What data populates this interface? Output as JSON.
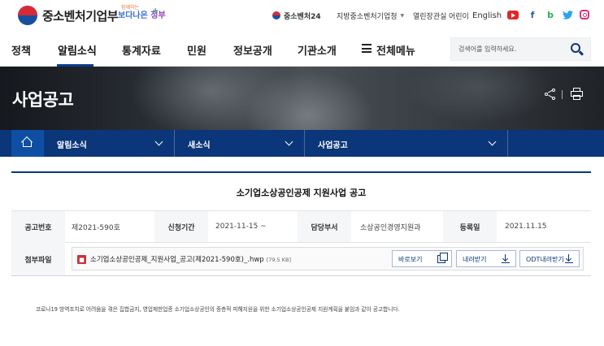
{
  "header": {
    "logo_text": "중소벤처기업부",
    "slogan_small": "함께하는",
    "slogan_big_1": "보다나은",
    "slogan_big_2": "정부",
    "utility": {
      "sme24": "중소벤처24",
      "region": "지방중소벤처기업청",
      "open": "열린장관실",
      "kids": "어린이",
      "english": "English"
    },
    "sns": [
      "youtube-icon",
      "facebook-icon",
      "blog-icon",
      "twitter-icon",
      "instagram-icon"
    ]
  },
  "gnb": {
    "items": [
      "정책",
      "알림소식",
      "통계자료",
      "민원",
      "정보공개",
      "기관소개"
    ],
    "active_index": 1,
    "all_menu": "전체메뉴",
    "search_placeholder": "검색어를 입력하세요."
  },
  "visual": {
    "title": "사업공고"
  },
  "breadcrumb": {
    "items": [
      "알림소식",
      "새소식",
      "사업공고"
    ]
  },
  "article": {
    "title": "소기업소상공인공제 지원사업 공고",
    "fields": {
      "notice_no_label": "공고번호",
      "notice_no": "제2021-590호",
      "period_label": "신청기간",
      "period": "2021-11-15 ~",
      "dept_label": "담당부서",
      "dept": "소상공인경영지원과",
      "date_label": "등록일",
      "date": "2021.11.15"
    },
    "attachment": {
      "label": "첨부파일",
      "file_name": "소기업소상공인공제_지원사업_공고(제2021-590호)_.hwp",
      "file_size": "[79.5 KB]",
      "view_label": "바로보기",
      "download_label": "내려받기",
      "odt_label": "ODT내려받기"
    },
    "body": "코로나19 방역조치로 어려움을 겪은 집합금지, 영업제한업종 소기업소상공인의 중층적 피해지원을 위한 소기업소상공인공제 지원계획을 붙임과 같이 공고합니다."
  },
  "colors": {
    "navy": "#0b3679",
    "home_blue": "#0f4fa3",
    "file_icon_red": "#c8323a"
  }
}
